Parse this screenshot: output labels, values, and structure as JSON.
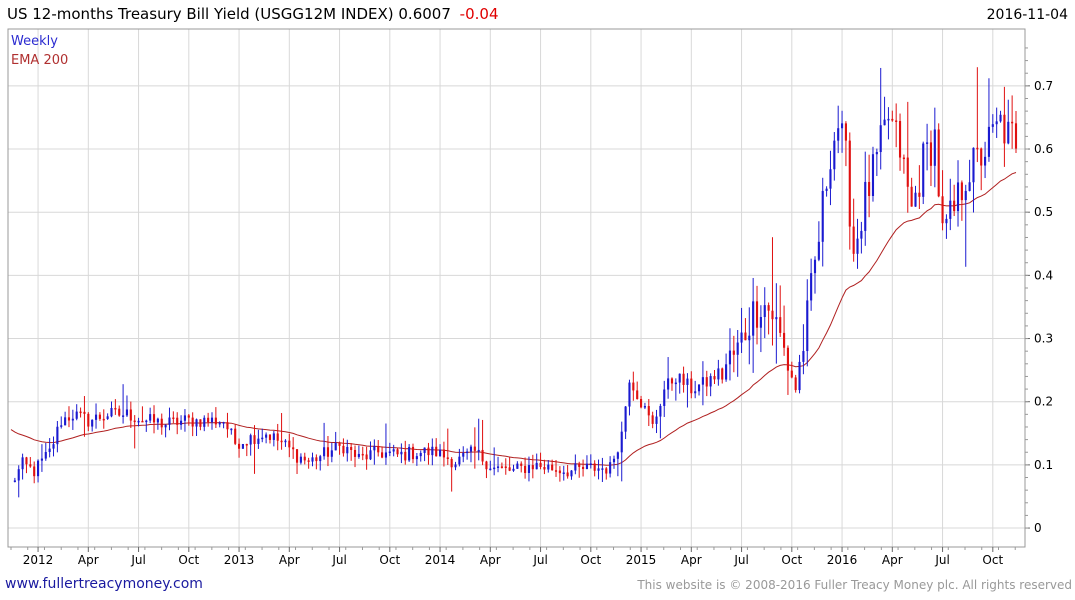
{
  "header": {
    "title": "US 12-months Treasury Bill Yield (USGG12M INDEX) 0.6007",
    "change": "-0.04",
    "date": "2016-11-04"
  },
  "footer": {
    "site_link": "www.fullertreacymoney.com",
    "copyright": "This website is © 2008-2016 Fuller Treacy Money plc. All rights reserved"
  },
  "colors": {
    "up": "#1a1ad0",
    "down": "#e01010",
    "ema": "#b02020",
    "grid": "#d8d8d8"
  },
  "chart_data": {
    "type": "candlestick",
    "legend": [
      "Weekly",
      "EMA 200"
    ],
    "legend_position": "top-left",
    "grid": true,
    "y_axis_side": "right",
    "ylim": [
      -0.03,
      0.79
    ],
    "y_ticks": [
      0,
      0.1,
      0.2,
      0.3,
      0.4,
      0.5,
      0.6,
      0.7
    ],
    "y_tick_labels": [
      "0",
      "0.1",
      "0.2",
      "0.3",
      "0.4",
      "0.5",
      "0.6",
      "0.7"
    ],
    "x_ticks": [
      {
        "label": "2012",
        "week": 7
      },
      {
        "label": "Apr",
        "week": 20
      },
      {
        "label": "Jul",
        "week": 33
      },
      {
        "label": "Oct",
        "week": 46
      },
      {
        "label": "2013",
        "week": 59
      },
      {
        "label": "Apr",
        "week": 72
      },
      {
        "label": "Jul",
        "week": 85
      },
      {
        "label": "Oct",
        "week": 98
      },
      {
        "label": "2014",
        "week": 111
      },
      {
        "label": "Apr",
        "week": 124
      },
      {
        "label": "Jul",
        "week": 137
      },
      {
        "label": "Oct",
        "week": 150
      },
      {
        "label": "2015",
        "week": 163
      },
      {
        "label": "Apr",
        "week": 176
      },
      {
        "label": "Jul",
        "week": 189
      },
      {
        "label": "Oct",
        "week": 202
      },
      {
        "label": "2016",
        "week": 215
      },
      {
        "label": "Apr",
        "week": 228
      },
      {
        "label": "Jul",
        "week": 241
      },
      {
        "label": "Oct",
        "week": 254
      }
    ],
    "anchors": [
      [
        0,
        0.07
      ],
      [
        3,
        0.1
      ],
      [
        6,
        0.09
      ],
      [
        10,
        0.12
      ],
      [
        13,
        0.17
      ],
      [
        16,
        0.18
      ],
      [
        20,
        0.17
      ],
      [
        25,
        0.18
      ],
      [
        30,
        0.18
      ],
      [
        35,
        0.17
      ],
      [
        40,
        0.165
      ],
      [
        45,
        0.17
      ],
      [
        50,
        0.17
      ],
      [
        55,
        0.17
      ],
      [
        58,
        0.135
      ],
      [
        63,
        0.145
      ],
      [
        66,
        0.15
      ],
      [
        70,
        0.135
      ],
      [
        74,
        0.115
      ],
      [
        77,
        0.105
      ],
      [
        82,
        0.12
      ],
      [
        86,
        0.13
      ],
      [
        90,
        0.11
      ],
      [
        95,
        0.12
      ],
      [
        100,
        0.115
      ],
      [
        105,
        0.12
      ],
      [
        110,
        0.12
      ],
      [
        115,
        0.105
      ],
      [
        120,
        0.12
      ],
      [
        125,
        0.095
      ],
      [
        130,
        0.09
      ],
      [
        135,
        0.1
      ],
      [
        140,
        0.095
      ],
      [
        145,
        0.09
      ],
      [
        150,
        0.095
      ],
      [
        155,
        0.095
      ],
      [
        158,
        0.15
      ],
      [
        160,
        0.24
      ],
      [
        163,
        0.2
      ],
      [
        166,
        0.16
      ],
      [
        169,
        0.22
      ],
      [
        172,
        0.24
      ],
      [
        176,
        0.22
      ],
      [
        180,
        0.23
      ],
      [
        184,
        0.25
      ],
      [
        188,
        0.28
      ],
      [
        191,
        0.33
      ],
      [
        194,
        0.36
      ],
      [
        197,
        0.34
      ],
      [
        200,
        0.28
      ],
      [
        203,
        0.22
      ],
      [
        206,
        0.33
      ],
      [
        209,
        0.46
      ],
      [
        212,
        0.6
      ],
      [
        214,
        0.64
      ],
      [
        216,
        0.58
      ],
      [
        218,
        0.44
      ],
      [
        221,
        0.52
      ],
      [
        224,
        0.58
      ],
      [
        227,
        0.65
      ],
      [
        230,
        0.6
      ],
      [
        233,
        0.5
      ],
      [
        236,
        0.58
      ],
      [
        239,
        0.62
      ],
      [
        241,
        0.46
      ],
      [
        244,
        0.5
      ],
      [
        247,
        0.56
      ],
      [
        250,
        0.58
      ],
      [
        253,
        0.61
      ],
      [
        256,
        0.64
      ],
      [
        258,
        0.62
      ],
      [
        260,
        0.6
      ]
    ],
    "last_close": 0.6007,
    "last_change": -0.04
  }
}
